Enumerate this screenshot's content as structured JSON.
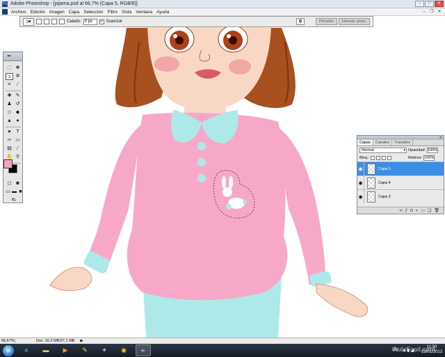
{
  "window": {
    "title": "Adobe Photoshop - [pijama.psd al 66,7% (Capa 5, RGB/8)]",
    "app_icon": "Ps"
  },
  "menu": {
    "items": [
      "Archivo",
      "Edición",
      "Imagen",
      "Capa",
      "Selección",
      "Filtro",
      "Vista",
      "Ventana",
      "Ayuda"
    ]
  },
  "options": {
    "feather_label": "Calado:",
    "feather_value": "0 px",
    "antialias_label": "Suavizar",
    "antialias_checked": true,
    "well_tabs": [
      "Pinceles",
      "Herram. prest."
    ]
  },
  "layers_panel": {
    "tabs": [
      "Capas",
      "Canales",
      "Trazados"
    ],
    "blend_mode": "Normal",
    "opacity_label": "Opacidad:",
    "opacity_value": "100%",
    "lock_label": "Bloq.:",
    "fill_label": "Relleno:",
    "fill_value": "100%",
    "layers": [
      {
        "name": "Capa 5",
        "selected": true
      },
      {
        "name": "Capa 4",
        "selected": false
      },
      {
        "name": "Capa 3",
        "selected": false
      }
    ]
  },
  "status": {
    "zoom": "66,67%",
    "doc": "Doc: 16,3 MB/27,1 MB"
  },
  "taskbar": {
    "lang": "ES",
    "time": "11:50",
    "date": "13/01/2013"
  },
  "watermark": "AulaFacil.com",
  "colors": {
    "foreground": "#f4a3c6",
    "background": "#000000",
    "selection": "#3a8ee6"
  }
}
